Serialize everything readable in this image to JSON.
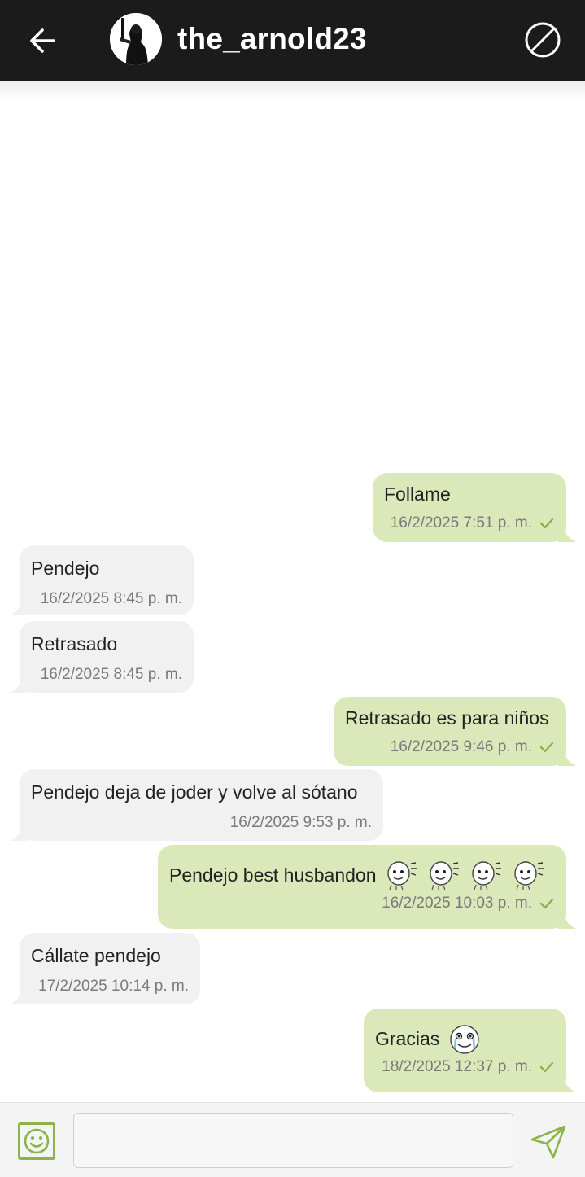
{
  "header": {
    "title": "the_arnold23",
    "back_icon": "arrow-left-icon",
    "block_icon": "block-icon",
    "background": "#1b1b1b"
  },
  "messages": [
    {
      "direction": "out",
      "text": "Follame",
      "time": "16/2/2025 7:51 p. m.",
      "status": "sent"
    },
    {
      "direction": "in",
      "text": "Pendejo",
      "time": "16/2/2025 8:45 p. m."
    },
    {
      "direction": "in",
      "text": "Retrasado",
      "time": "16/2/2025 8:45 p. m."
    },
    {
      "direction": "out",
      "text": "Retrasado es para niños",
      "time": "16/2/2025 9:46 p. m.",
      "status": "sent"
    },
    {
      "direction": "in",
      "text": "Pendejo deja de joder y volve al sótano",
      "time": "16/2/2025 9:53 p. m."
    },
    {
      "direction": "out",
      "text": "Pendejo best husbandon",
      "emojis": [
        "meme-face-icon",
        "meme-face-icon",
        "meme-face-icon",
        "meme-face-icon"
      ],
      "time": "16/2/2025 10:03 p. m.",
      "status": "sent"
    },
    {
      "direction": "in",
      "text": "Cállate pendejo",
      "time": "17/2/2025 10:14 p. m."
    },
    {
      "direction": "out",
      "text": "Gracias",
      "emojis": [
        "crying-meme-face-icon"
      ],
      "time": "18/2/2025 12:37 p. m.",
      "status": "sent"
    }
  ],
  "input": {
    "placeholder": "",
    "value": "",
    "emoji_icon": "smiley-icon",
    "send_icon": "send-icon"
  },
  "colors": {
    "outgoing_bubble": "#dbe8b9",
    "incoming_bubble": "#f1f1f1",
    "accent": "#8ab44a"
  }
}
